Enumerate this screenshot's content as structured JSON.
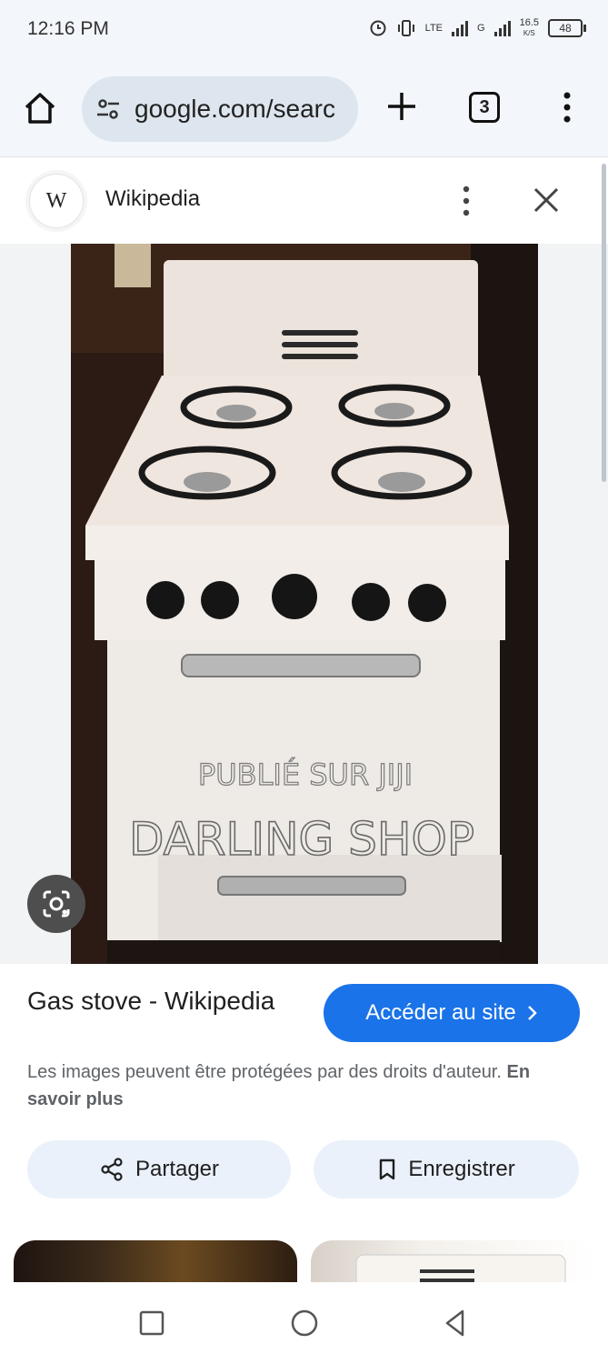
{
  "status_bar": {
    "time": "12:16 PM",
    "network_lte": "LTE",
    "network_g": "G",
    "speed": "16.5",
    "speed_unit": "K/S",
    "battery": "48"
  },
  "browser": {
    "url": "google.com/searc",
    "tab_count": "3"
  },
  "source": {
    "logo_letter": "W",
    "name": "Wikipedia"
  },
  "image": {
    "watermark_line1": "PUBLIÉ SUR JIJI",
    "watermark_line2": "DARLING SHOP"
  },
  "result": {
    "title": "Gas stove - Wikipedia",
    "visit_label": "Accéder au site",
    "copyright_text": "Les images peuvent être protégées par des droits d'auteur.",
    "learn_more": "En savoir plus",
    "share_label": "Partager",
    "save_label": "Enregistrer"
  },
  "colors": {
    "accent": "#1a73e8",
    "chip_bg": "#eaf1fb",
    "browser_bg": "#f3f6fb"
  },
  "icons": [
    "home-icon",
    "tune-icon",
    "plus-icon",
    "tabs-icon",
    "more-vert-icon",
    "close-icon",
    "lens-icon",
    "share-icon",
    "bookmark-icon",
    "chevron-right-icon",
    "nav-recents-icon",
    "nav-home-icon",
    "nav-back-icon"
  ]
}
